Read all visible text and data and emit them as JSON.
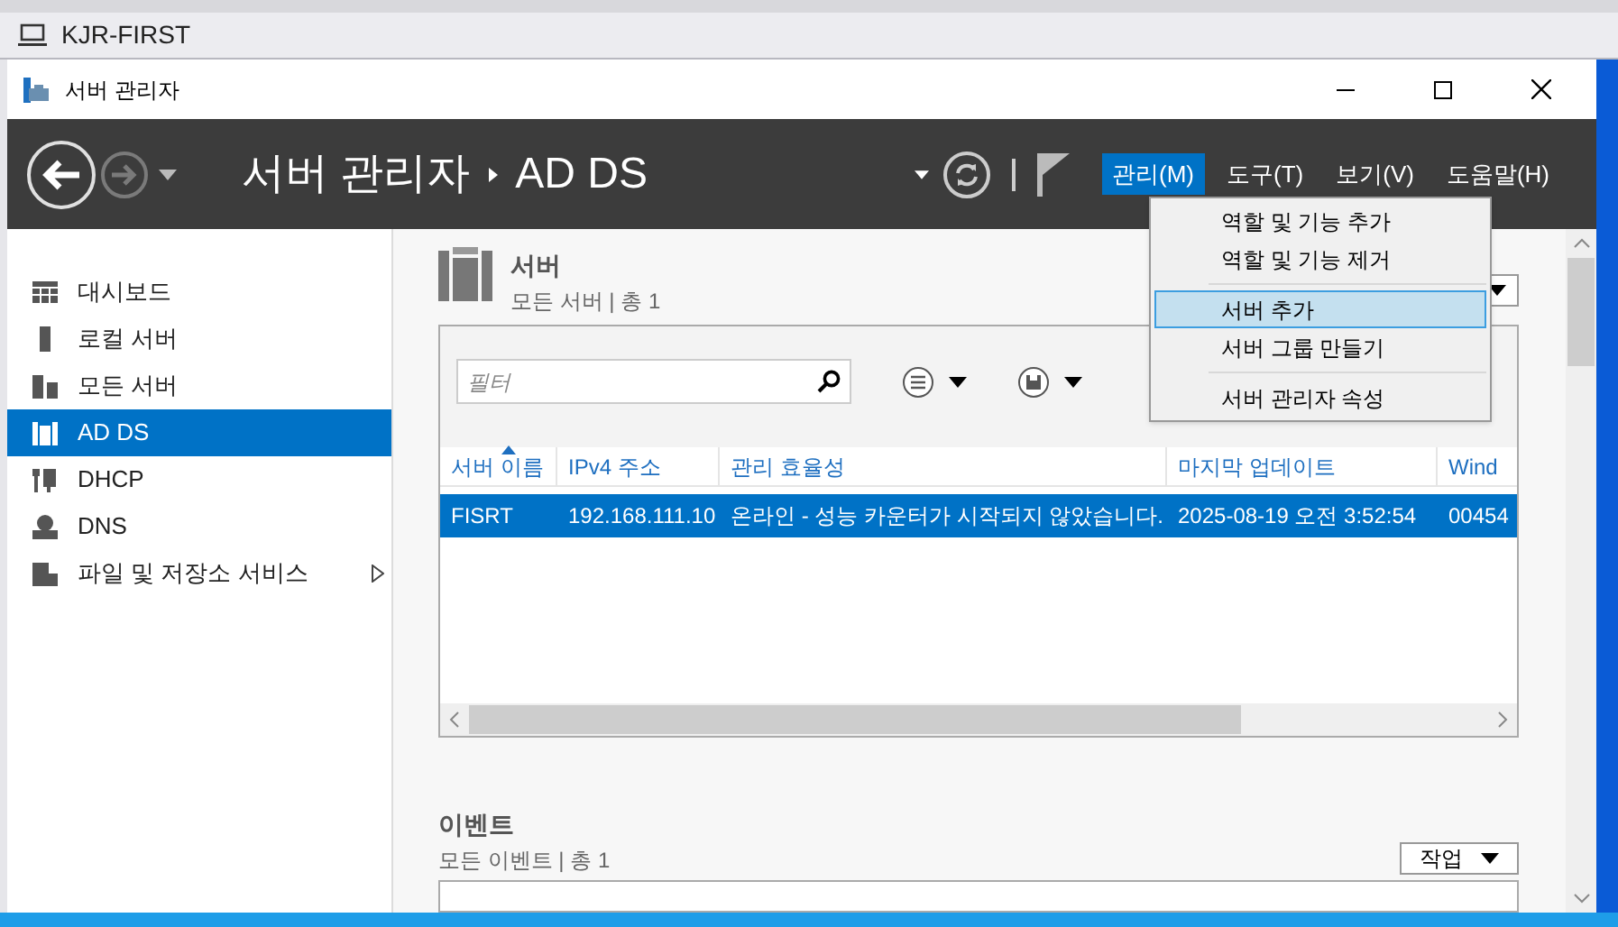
{
  "vm_window": {
    "title": "KJR-FIRST"
  },
  "window": {
    "title": "서버 관리자"
  },
  "breadcrumb": [
    "서버 관리자",
    "AD DS"
  ],
  "menus": [
    {
      "label": "관리(M)",
      "selected": true
    },
    {
      "label": "도구(T)",
      "selected": false
    },
    {
      "label": "보기(V)",
      "selected": false
    },
    {
      "label": "도움말(H)",
      "selected": false
    }
  ],
  "open_menu": {
    "items": [
      {
        "kind": "item",
        "label": "역할 및 기능 추가",
        "selected": false
      },
      {
        "kind": "item",
        "label": "역할 및 기능 제거",
        "selected": false
      },
      {
        "kind": "separator"
      },
      {
        "kind": "item",
        "label": "서버 추가",
        "selected": true
      },
      {
        "kind": "item",
        "label": "서버 그룹 만들기",
        "selected": false
      },
      {
        "kind": "separator"
      },
      {
        "kind": "item",
        "label": "서버 관리자 속성",
        "selected": false
      }
    ]
  },
  "sidebar": {
    "items": [
      {
        "label": "대시보드",
        "selected": false,
        "expandable": false
      },
      {
        "label": "로컬 서버",
        "selected": false,
        "expandable": false
      },
      {
        "label": "모든 서버",
        "selected": false,
        "expandable": false
      },
      {
        "label": "AD DS",
        "selected": true,
        "expandable": false
      },
      {
        "label": "DHCP",
        "selected": false,
        "expandable": false
      },
      {
        "label": "DNS",
        "selected": false,
        "expandable": false
      },
      {
        "label": "파일 및 저장소 서비스",
        "selected": false,
        "expandable": true
      }
    ]
  },
  "servers_panel": {
    "title": "서버",
    "subtitle": "모든 서버 | 총 1",
    "filter_placeholder": "필터",
    "columns": [
      {
        "label": "서버 이름",
        "sorted": true
      },
      {
        "label": "IPv4 주소",
        "sorted": false
      },
      {
        "label": "관리 효율성",
        "sorted": false
      },
      {
        "label": "마지막 업데이트",
        "sorted": false
      },
      {
        "label": "Wind",
        "sorted": false
      }
    ],
    "rows": [
      {
        "selected": true,
        "cells": [
          "FISRT",
          "192.168.111.10",
          "온라인 - 성능 카운터가 시작되지 않았습니다.",
          "2025-08-19 오전 3:52:54",
          "00454"
        ]
      }
    ]
  },
  "events_panel": {
    "title": "이벤트",
    "subtitle": "모든 이벤트 | 총 1",
    "tasks_button": "작업"
  }
}
